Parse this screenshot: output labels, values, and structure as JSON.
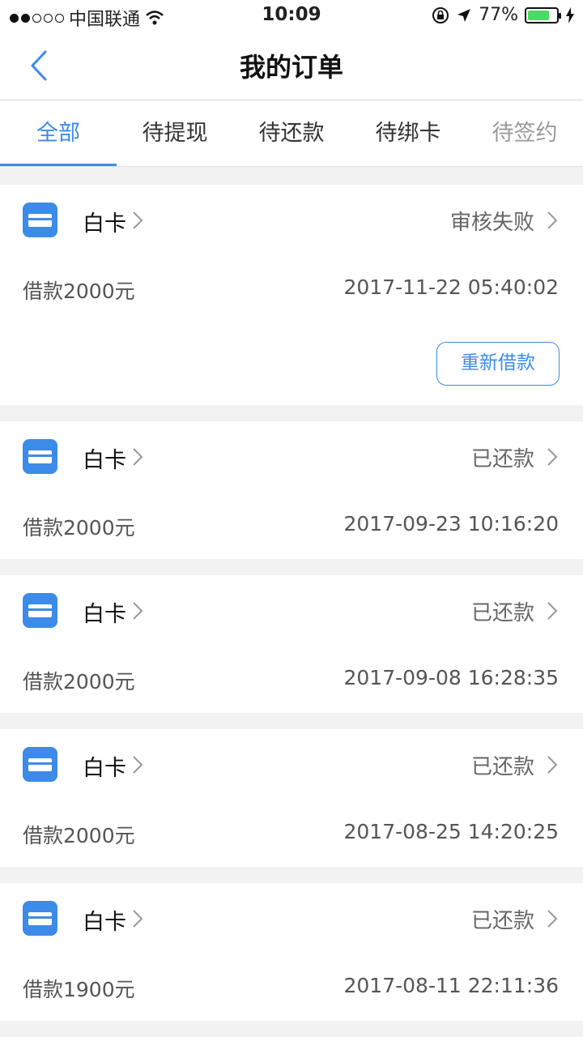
{
  "status_bar": {
    "carrier": "中国联通",
    "time": "10:09",
    "battery": "77%",
    "battery_level": 0.77
  },
  "nav": {
    "title": "我的订单"
  },
  "tabs": [
    {
      "label": "全部",
      "active": true
    },
    {
      "label": "待提现",
      "active": false
    },
    {
      "label": "待还款",
      "active": false
    },
    {
      "label": "待绑卡",
      "active": false
    },
    {
      "label": "待签约",
      "active": false
    }
  ],
  "orders": [
    {
      "product": "白卡",
      "status": "审核失败",
      "amount": "借款2000元",
      "time": "2017-11-22 05:40:02",
      "action": "重新借款"
    },
    {
      "product": "白卡",
      "status": "已还款",
      "amount": "借款2000元",
      "time": "2017-09-23 10:16:20"
    },
    {
      "product": "白卡",
      "status": "已还款",
      "amount": "借款2000元",
      "time": "2017-09-08 16:28:35"
    },
    {
      "product": "白卡",
      "status": "已还款",
      "amount": "借款2000元",
      "time": "2017-08-25 14:20:25"
    },
    {
      "product": "白卡",
      "status": "已还款",
      "amount": "借款1900元",
      "time": "2017-08-11 22:11:36"
    }
  ],
  "colors": {
    "accent": "#3d8be8",
    "battery": "#4cd964"
  },
  "icons": {
    "back": "chevron-left-icon",
    "card": "card-icon",
    "chevron": "chevron-right-icon"
  }
}
